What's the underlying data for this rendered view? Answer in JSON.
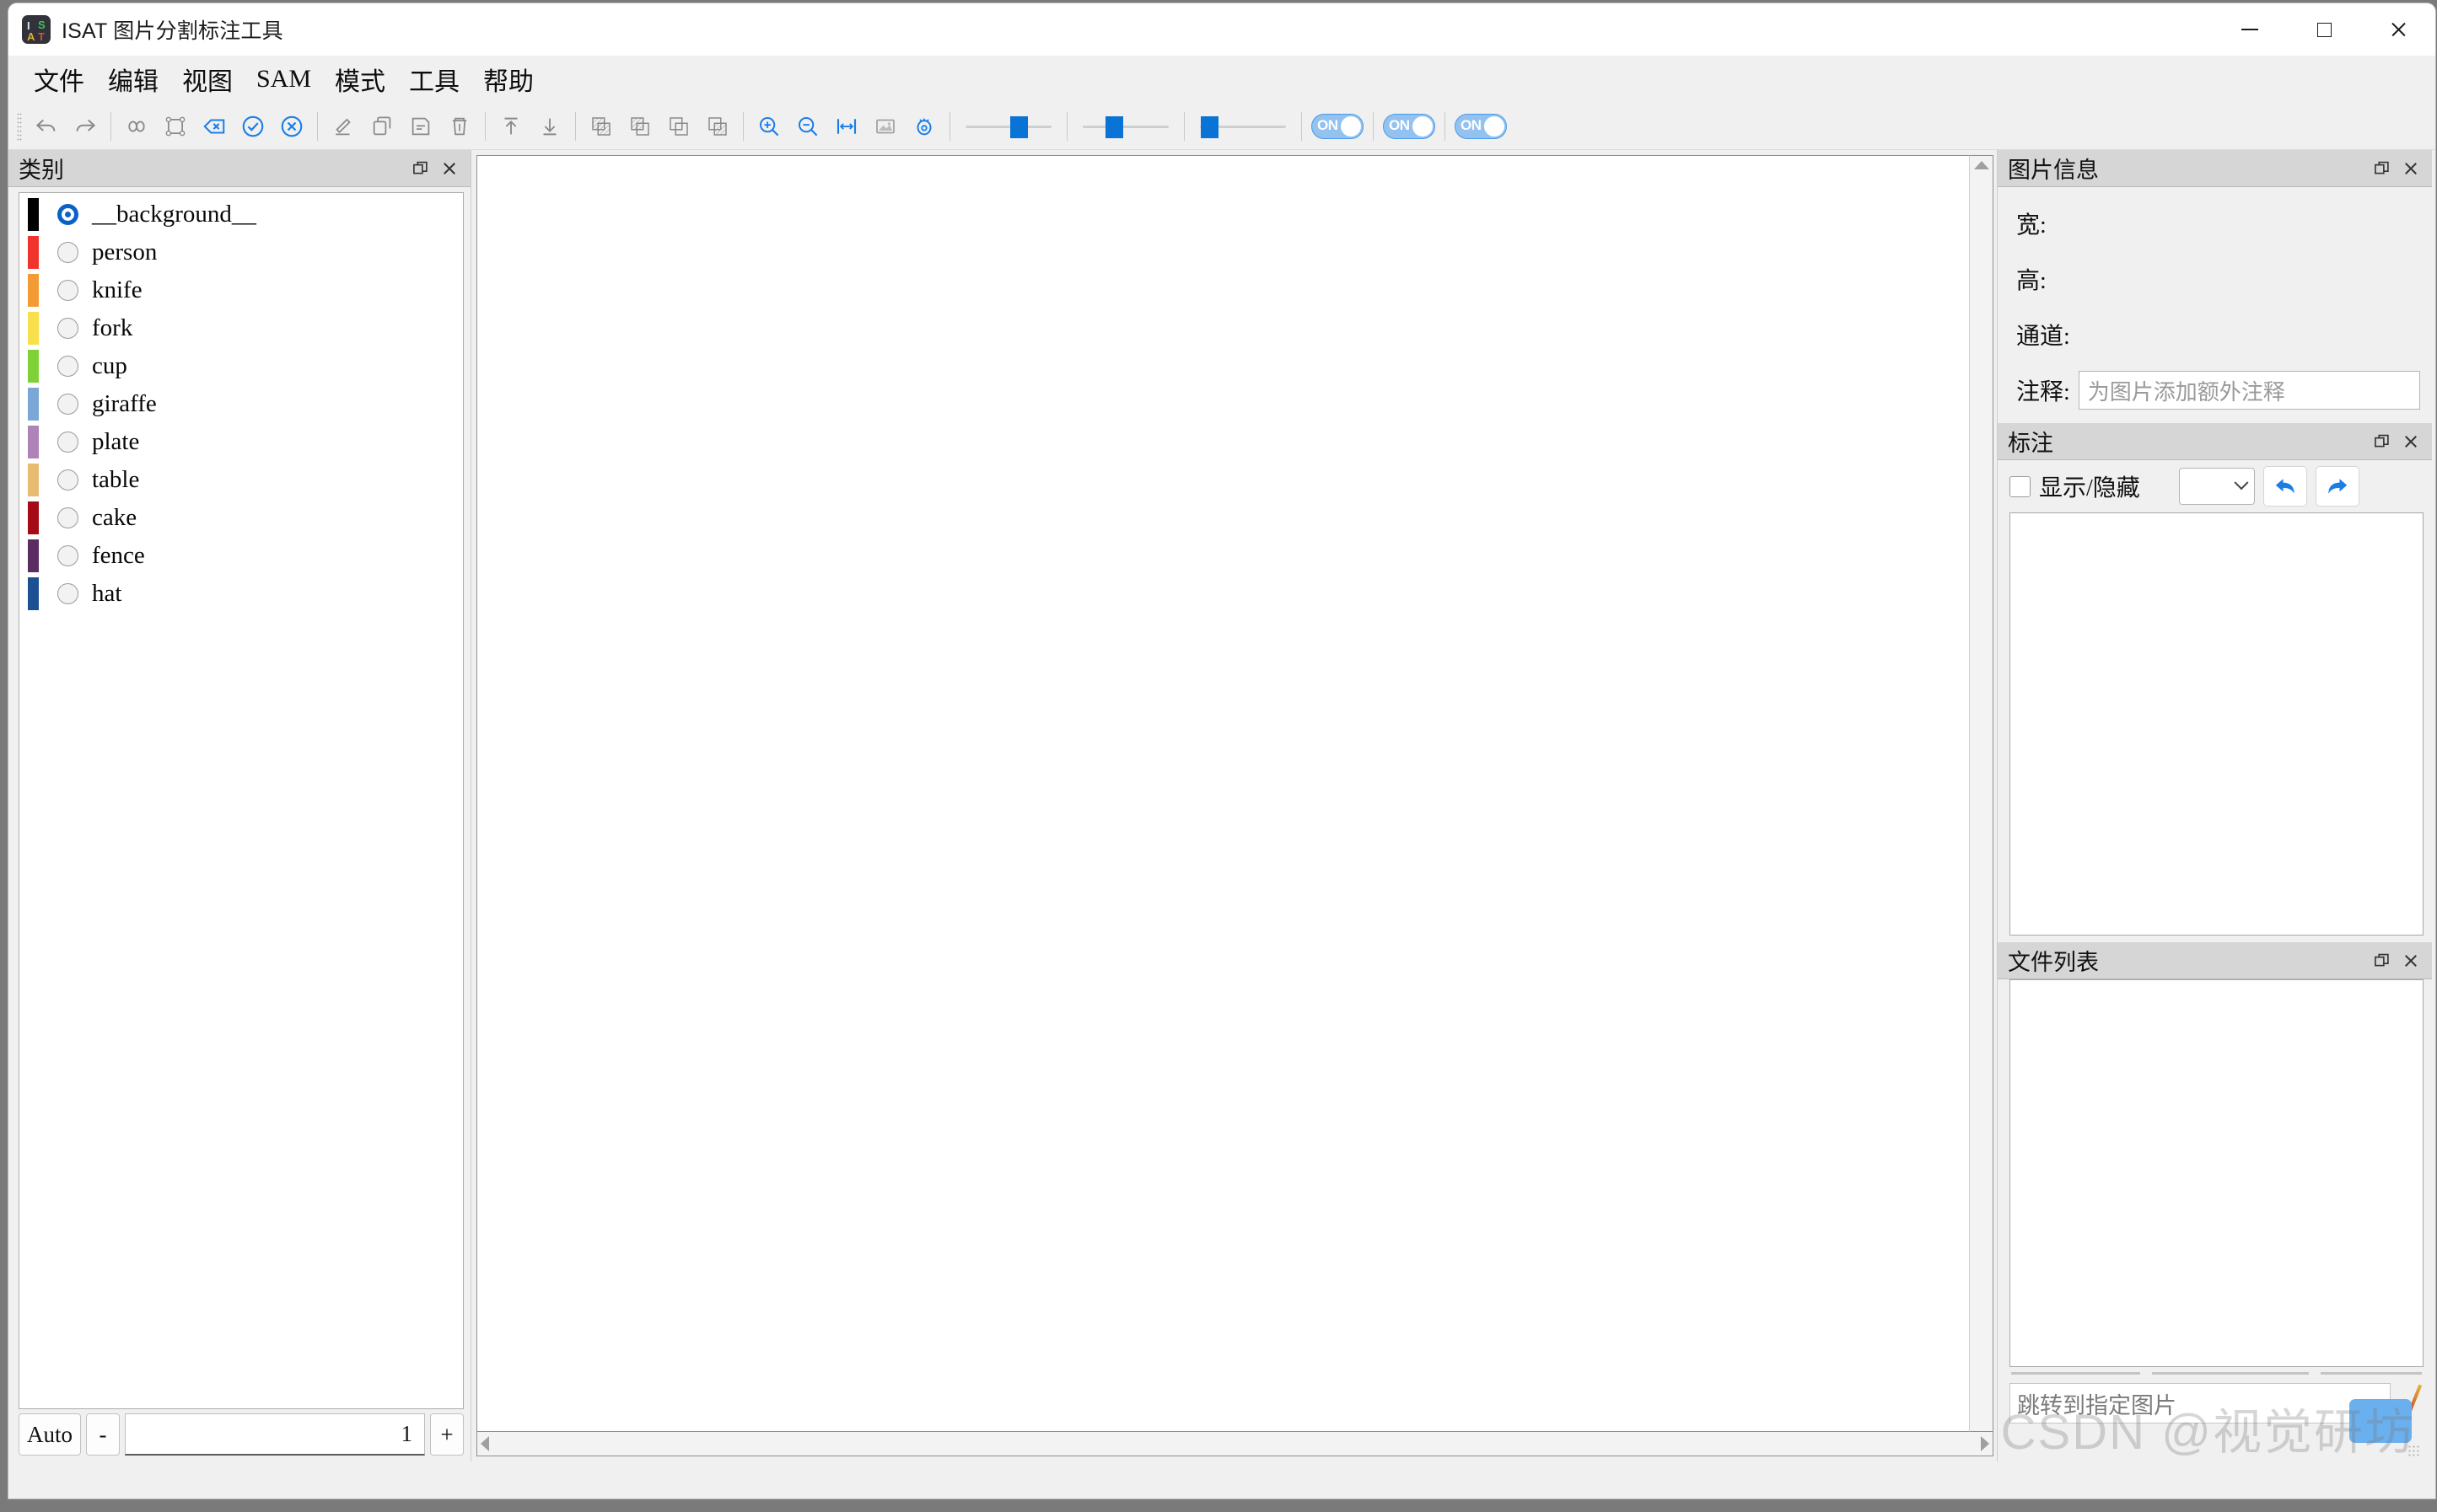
{
  "window": {
    "title": "ISAT 图片分割标注工具",
    "icon_letters": [
      "I",
      "S",
      "A",
      "T"
    ],
    "controls": {
      "minimize": "−",
      "maximize": "□",
      "close": "✕"
    }
  },
  "menubar": {
    "items": [
      {
        "label": "文件",
        "name": "menu-file"
      },
      {
        "label": "编辑",
        "name": "menu-edit"
      },
      {
        "label": "视图",
        "name": "menu-view"
      },
      {
        "label": "SAM",
        "name": "menu-sam"
      },
      {
        "label": "模式",
        "name": "menu-mode"
      },
      {
        "label": "工具",
        "name": "menu-tools"
      },
      {
        "label": "帮助",
        "name": "menu-help"
      }
    ]
  },
  "toolbar": {
    "icons": [
      "undo-icon",
      "redo-icon",
      "segment-anything-icon",
      "bbox-icon",
      "delete-polygon-icon",
      "accept-icon",
      "reject-icon",
      "edit-icon",
      "copy-icon",
      "save-icon",
      "trash-icon",
      "to-top-icon",
      "to-bottom-icon",
      "layer-all-icon",
      "layer-up-icon",
      "layer-front-icon",
      "layer-mix-icon",
      "zoom-in-icon",
      "zoom-out-icon",
      "fit-width-icon",
      "fit-window-icon",
      "visibility-icon"
    ],
    "sliders": [
      {
        "name": "mask-alpha-slider",
        "value": 52
      },
      {
        "name": "vertex-size-slider",
        "value": 30
      },
      {
        "name": "contour-width-slider",
        "value": 12
      }
    ],
    "toggles": [
      {
        "name": "toggle-show-mask",
        "label": "ON",
        "state": "on"
      },
      {
        "name": "toggle-show-vertex",
        "label": "ON",
        "state": "on"
      },
      {
        "name": "toggle-show-contour",
        "label": "ON",
        "state": "on"
      }
    ]
  },
  "category_panel": {
    "title": "类别",
    "selected": "__background__",
    "items": [
      {
        "label": "__background__",
        "color": "#000000",
        "selected": true
      },
      {
        "label": "person",
        "color": "#f0332c",
        "selected": false
      },
      {
        "label": "knife",
        "color": "#f49a34",
        "selected": false
      },
      {
        "label": "fork",
        "color": "#f7e04c",
        "selected": false
      },
      {
        "label": "cup",
        "color": "#7ed235",
        "selected": false
      },
      {
        "label": "giraffe",
        "color": "#7ba7d7",
        "selected": false
      },
      {
        "label": "plate",
        "color": "#ae83b8",
        "selected": false
      },
      {
        "label": "table",
        "color": "#e7bb72",
        "selected": false
      },
      {
        "label": "cake",
        "color": "#a50b15",
        "selected": false
      },
      {
        "label": "fence",
        "color": "#5c2d62",
        "selected": false
      },
      {
        "label": "hat",
        "color": "#1d4f93",
        "selected": false
      }
    ]
  },
  "zoom_bar": {
    "auto_label": "Auto",
    "minus_label": "-",
    "plus_label": "+",
    "value": "1"
  },
  "image_info_panel": {
    "title": "图片信息",
    "fields": [
      {
        "label": "宽:",
        "value": ""
      },
      {
        "label": "高:",
        "value": ""
      },
      {
        "label": "通道:",
        "value": ""
      }
    ],
    "note_label": "注释:",
    "note_value": "",
    "note_placeholder": "为图片添加额外注释"
  },
  "annotation_panel": {
    "title": "标注",
    "show_hide_label": "显示/隐藏",
    "show_hide_checked": false,
    "combo_value": "",
    "prev_icon": "undo-arrow-icon",
    "next_icon": "redo-arrow-icon",
    "items": []
  },
  "file_list_panel": {
    "title": "文件列表",
    "items": [],
    "jump_placeholder": "跳转到指定图片",
    "jump_value": ""
  },
  "watermark": "CSDN @视觉研坊"
}
